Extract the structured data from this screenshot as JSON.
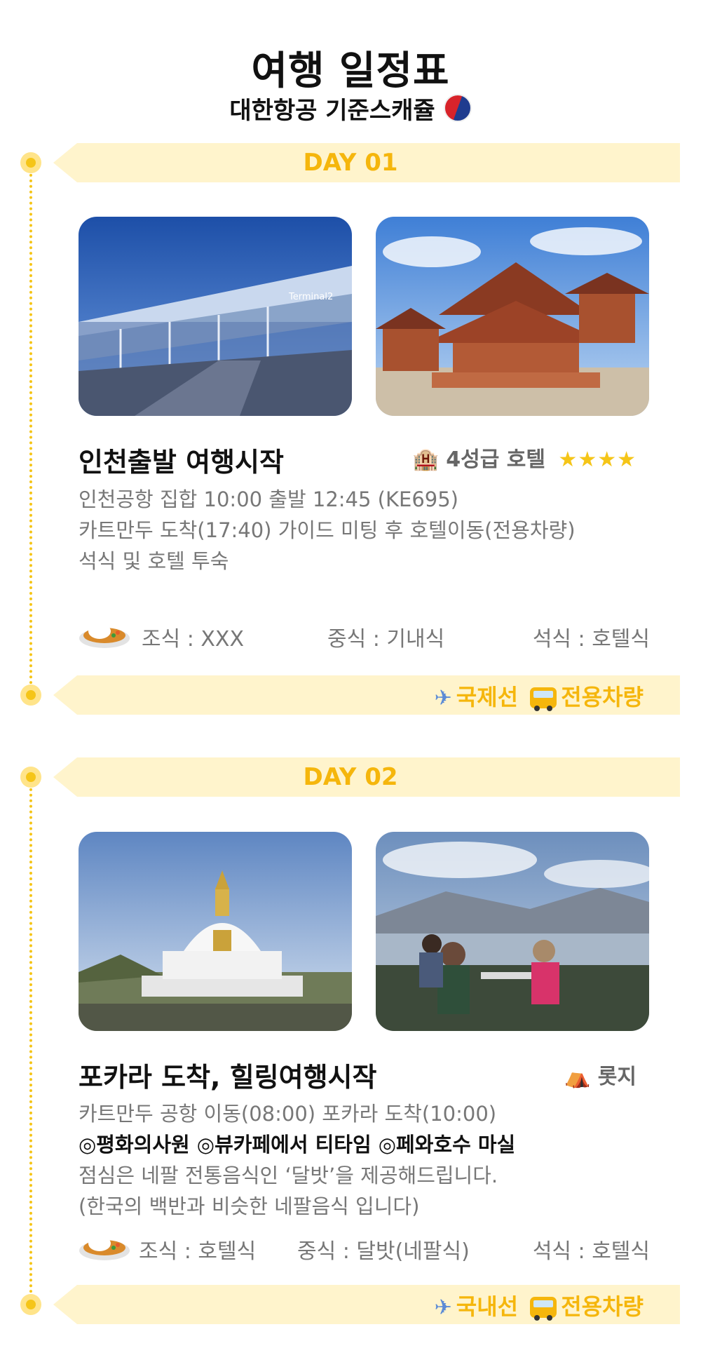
{
  "header": {
    "title": "여행 일정표",
    "subtitle": "대한항공 기준스캐쥴",
    "flag_icon": "korean-air-logo"
  },
  "colors": {
    "accent": "#f5b60c",
    "banner_bg": "#fff4cc",
    "dot": "#f5c518"
  },
  "days": [
    {
      "label": "DAY 01",
      "photos": [
        "incheon-airport-terminal-photo",
        "kathmandu-temple-photo"
      ],
      "title": "인천출발 여행시작",
      "hotel": {
        "icon": "hotel-icon",
        "text": "4성급 호텔",
        "stars": "★★★★"
      },
      "desc": [
        "인천공항 집합 10:00 출발 12:45 (KE695)",
        "카트만두 도착(17:40) 가이드 미팅 후 호텔이동(전용차량)",
        "석식 및 호텔 투숙"
      ],
      "meals": {
        "breakfast": "조식 : XXX",
        "lunch": "중식 : 기내식",
        "dinner": "석식 : 호텔식"
      },
      "transport": {
        "flight": "국제선",
        "vehicle": "전용차량"
      }
    },
    {
      "label": "DAY 02",
      "photos": [
        "world-peace-pagoda-photo",
        "view-cafe-lake-photo"
      ],
      "title": "포카라 도착, 힐링여행시작",
      "lodging": {
        "icon": "tent-icon",
        "text": "롯지"
      },
      "desc": [
        "카트만두 공항 이동(08:00) 포카라 도착(10:00)",
        "◎평화의사원  ◎뷰카페에서 티타임 ◎페와호수 마실",
        "점심은 네팔 전통음식인 ‘달밧’을 제공해드립니다.",
        "(한국의 백반과 비슷한 네팔음식 입니다)"
      ],
      "meals": {
        "breakfast": "조식 : 호텔식",
        "lunch": "중식 : 달밧(네팔식)",
        "dinner": "석식 : 호텔식"
      },
      "transport": {
        "flight": "국내선",
        "vehicle": "전용차량"
      }
    }
  ]
}
